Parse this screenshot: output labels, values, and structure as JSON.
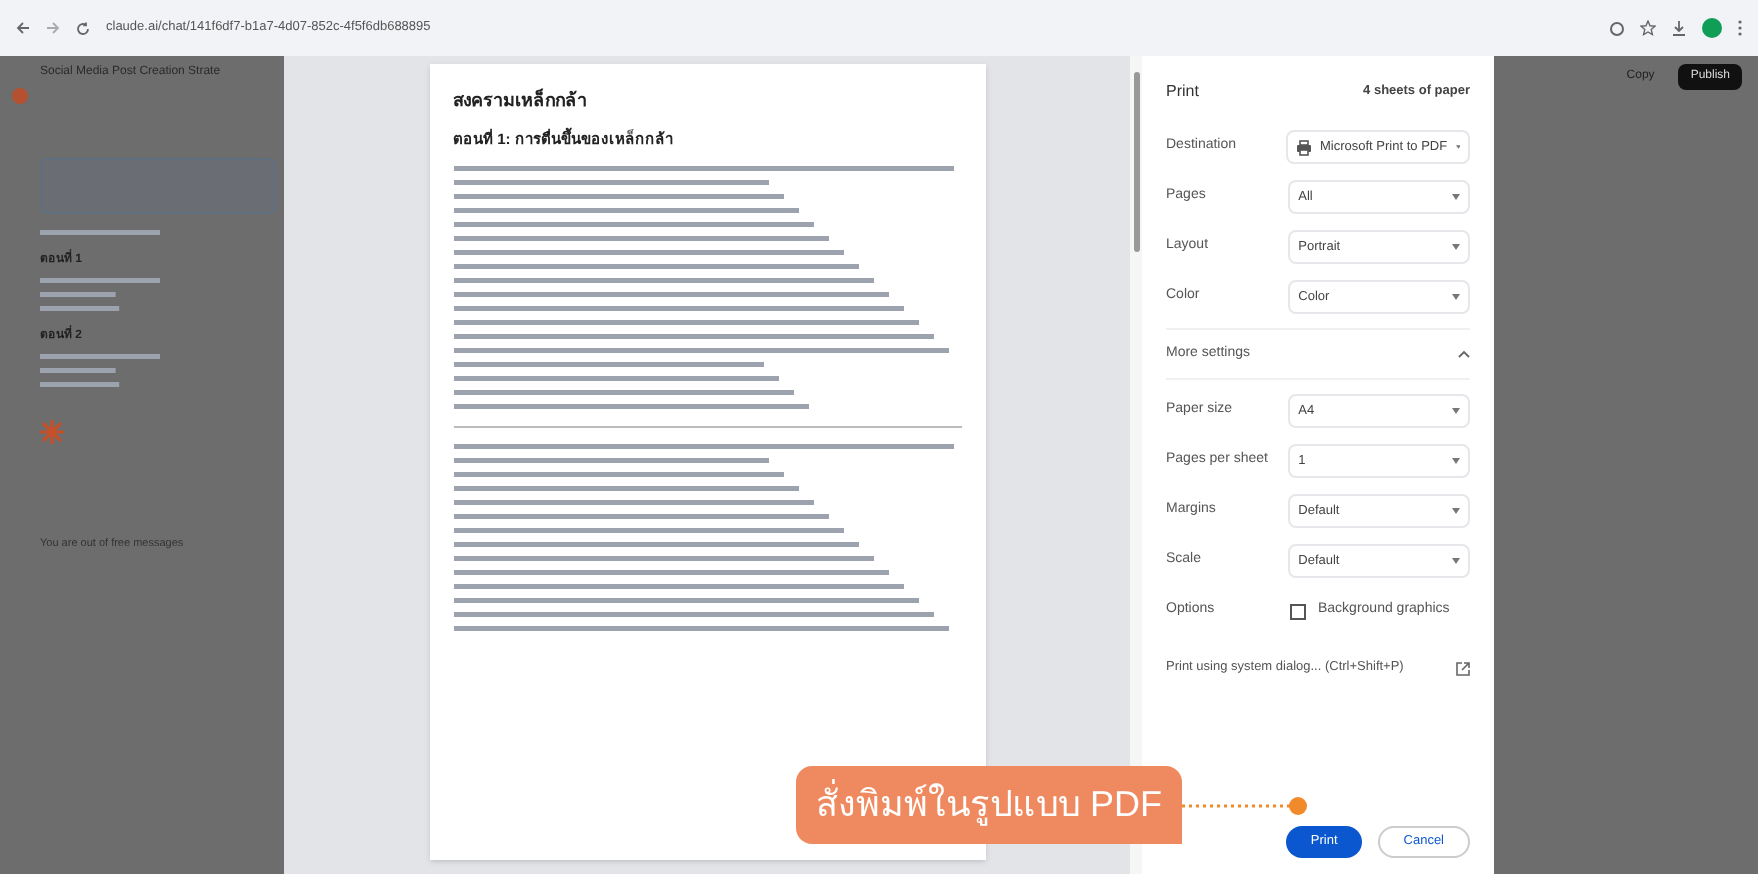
{
  "browser": {
    "url": "claude.ai/chat/141f6df7-b1a7-4d07-852c-4f5f6db688895"
  },
  "app": {
    "title": "Social Media Post Creation Strate",
    "sections": [
      {
        "label": "ตอนที่ 1"
      },
      {
        "label": "ตอนที่ 2"
      }
    ],
    "notice": "You are out of free messages",
    "actions": [
      {
        "label": "Copy",
        "primary": false
      },
      {
        "label": "Publish",
        "primary": true
      }
    ]
  },
  "preview": {
    "title": "สงครามเหล็กกล้า",
    "heading": "ตอนที่ 1: การตื่นขึ้นของเหล็กกล้า"
  },
  "print": {
    "title": "Print",
    "sheets": "4 sheets of paper",
    "settings": [
      {
        "kind": "select",
        "label": "Destination",
        "value": "Microsoft Print to PDF",
        "printer": true
      },
      {
        "kind": "select",
        "label": "Pages",
        "value": "All"
      },
      {
        "kind": "select",
        "label": "Layout",
        "value": "Portrait"
      },
      {
        "kind": "select",
        "label": "Color",
        "value": "Color"
      },
      {
        "kind": "toggle",
        "label": "More settings",
        "expanded": true
      },
      {
        "kind": "select",
        "label": "Paper size",
        "value": "A4"
      },
      {
        "kind": "select",
        "label": "Pages per sheet",
        "value": "1"
      },
      {
        "kind": "select",
        "label": "Margins",
        "value": "Default"
      },
      {
        "kind": "select",
        "label": "Scale",
        "value": "Default"
      },
      {
        "kind": "checkbox",
        "label": "Options",
        "value": "Background graphics",
        "checked": false
      },
      {
        "kind": "link",
        "label": "Print using system dialog... (Ctrl+Shift+P)"
      }
    ],
    "buttons": [
      {
        "label": "Print",
        "primary": true
      },
      {
        "label": "Cancel",
        "primary": false
      }
    ]
  },
  "callout": {
    "text": "สั่งพิมพ์ในรูปแบบ PDF"
  }
}
